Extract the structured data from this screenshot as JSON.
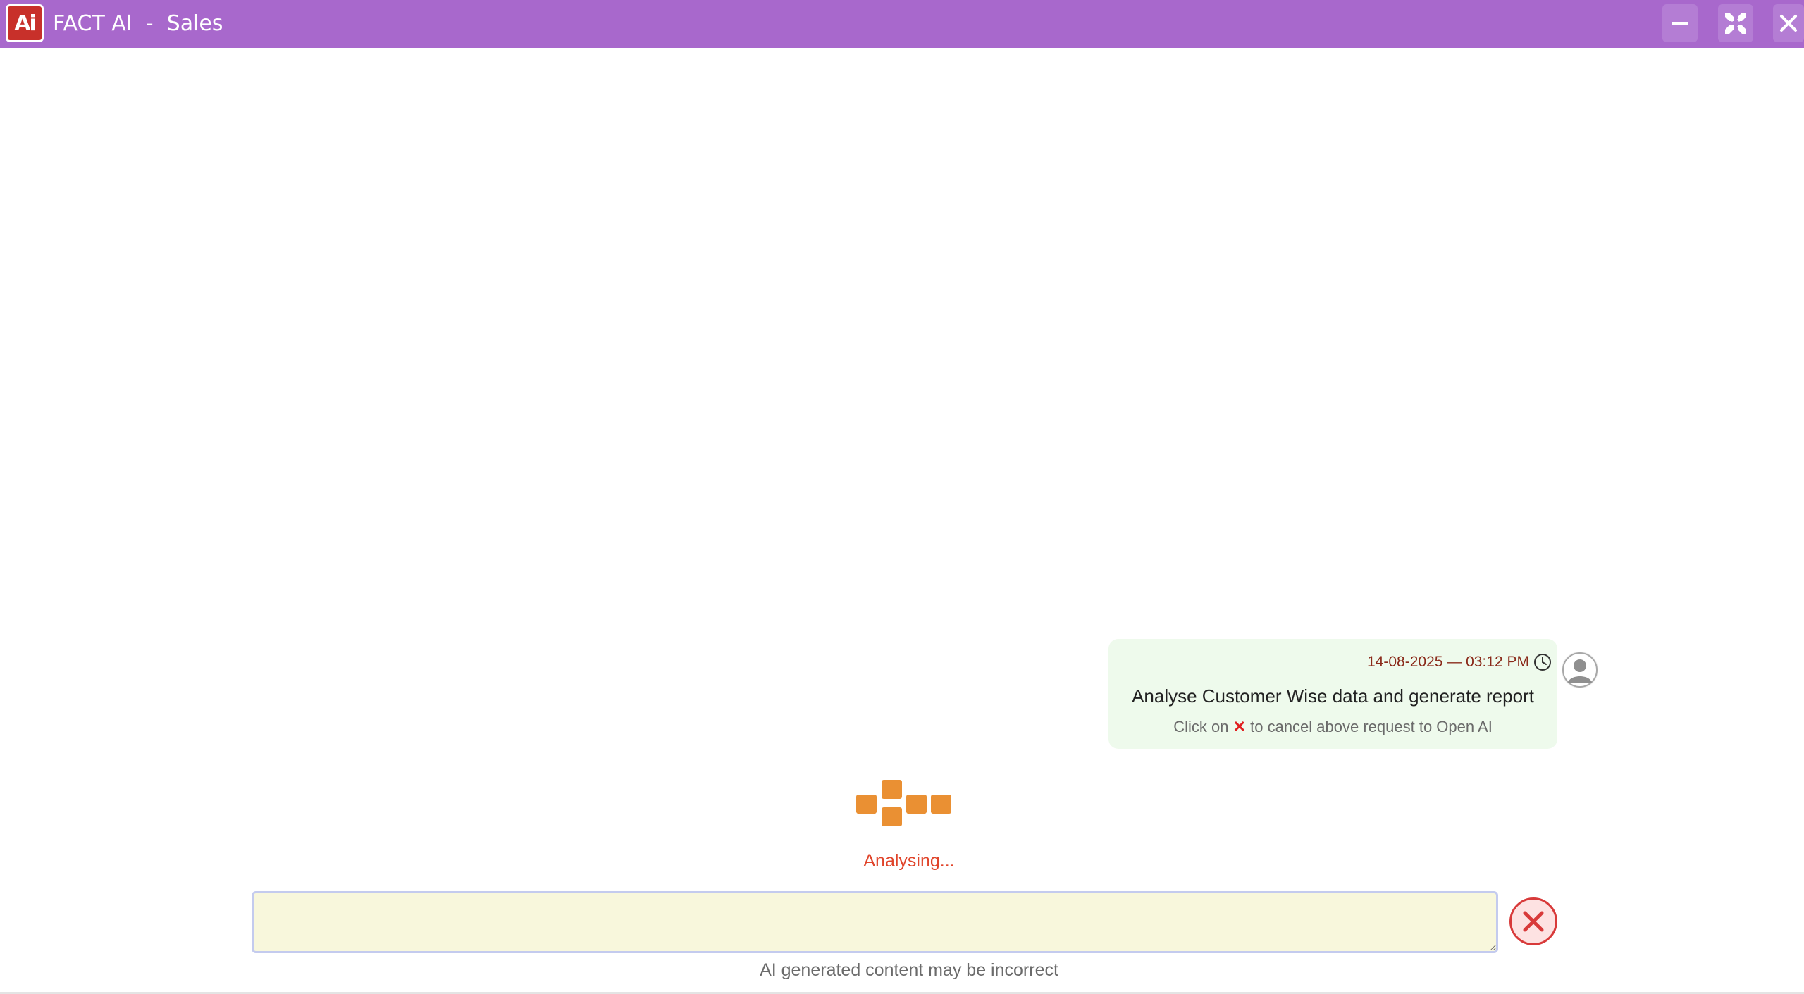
{
  "window": {
    "app_name": "FACT AI",
    "separator": "-",
    "module": "Sales",
    "logo_text": "Ai",
    "accent_color": "#a868cc",
    "icons": {
      "minimize": "minimize-icon",
      "restore": "restore-icon",
      "close": "close-icon"
    }
  },
  "chat": {
    "messages": [
      {
        "role": "user",
        "timestamp": "14-08-2025 — 03:12 PM",
        "text": "Analyse Customer Wise data and generate report",
        "hint_before": "Click on",
        "hint_x": "✕",
        "hint_after": "to cancel above request to Open AI",
        "bubble_color": "#eefaec"
      }
    ]
  },
  "status": {
    "text": "Analysing...",
    "loader_color": "#ea9033"
  },
  "input": {
    "value": "",
    "placeholder": ""
  },
  "footer": {
    "disclaimer": "AI generated content may be incorrect"
  }
}
